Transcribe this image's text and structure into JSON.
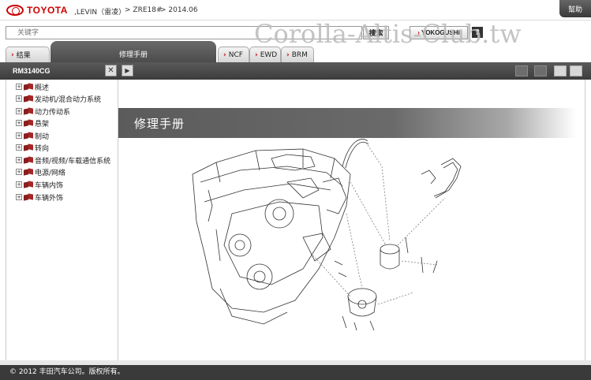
{
  "header": {
    "brand": "TOYOTA",
    "model": ",LEVIN（雷凌）",
    "engine": "> ZRE18#",
    "date": "> 2014.06",
    "help_label": "幫助"
  },
  "search": {
    "placeholder": "关键字",
    "search_label": "搜索",
    "yokogushi_label": "YOKOGUSHI",
    "help_q": "?"
  },
  "watermark": "Corolla-Altis-Club.tw",
  "tabs": {
    "results_label": "结果",
    "main_label": "修理手册",
    "ncf_label": "NCF",
    "ewd_label": "EWD",
    "brm_label": "BRM"
  },
  "toolbar": {
    "manual_code": "RM3140CG",
    "close_glyph": "✕",
    "play_glyph": "▶"
  },
  "tree": {
    "items": [
      {
        "label": "概述"
      },
      {
        "label": "发动机/混合动力系统"
      },
      {
        "label": "动力传动系"
      },
      {
        "label": "悬架"
      },
      {
        "label": "制动"
      },
      {
        "label": "转向"
      },
      {
        "label": "音频/视频/车载通信系统"
      },
      {
        "label": "电源/网络"
      },
      {
        "label": "车辆内饰"
      },
      {
        "label": "车辆外饰"
      }
    ],
    "expander_glyph": "+"
  },
  "content": {
    "title": "修理手册"
  },
  "footer": {
    "copyright": "© 2012 丰田汽车公司。版权所有。"
  }
}
